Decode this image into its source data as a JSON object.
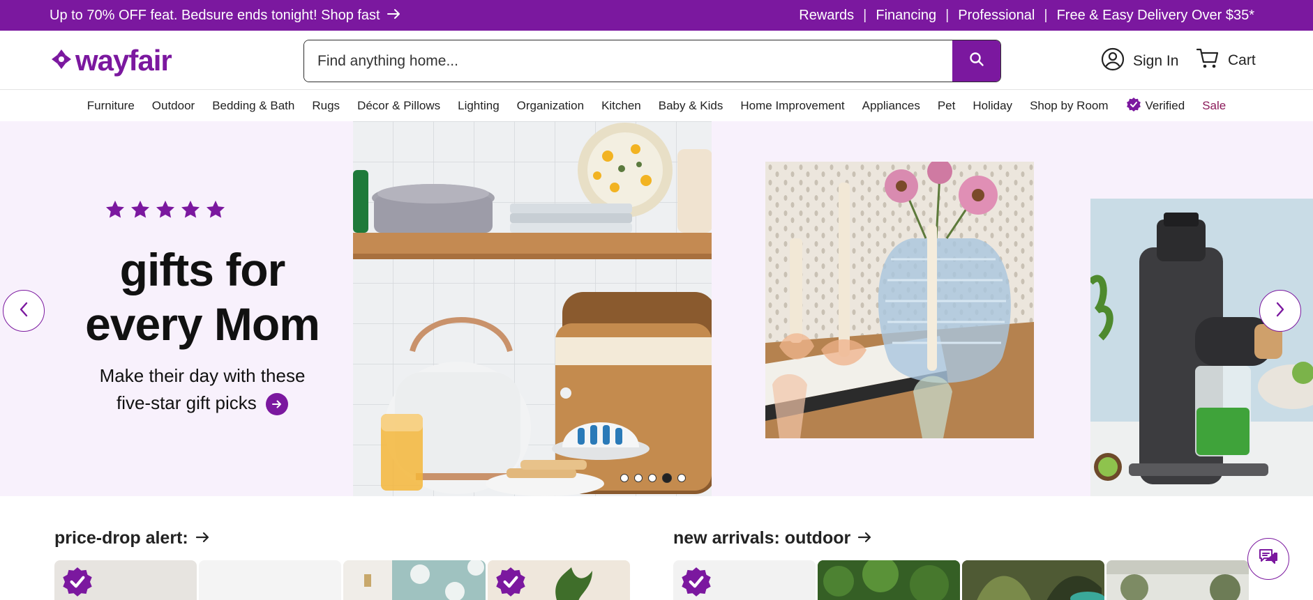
{
  "promo": {
    "text": "Up to 70% OFF feat. Bedsure ends tonight! Shop fast",
    "links": [
      "Rewards",
      "Financing",
      "Professional",
      "Free & Easy Delivery Over $35*"
    ]
  },
  "header": {
    "logo": "wayfair",
    "search_placeholder": "Find anything home...",
    "sign_in": "Sign In",
    "cart": "Cart"
  },
  "categories": [
    "Furniture",
    "Outdoor",
    "Bedding & Bath",
    "Rugs",
    "Décor & Pillows",
    "Lighting",
    "Organization",
    "Kitchen",
    "Baby & Kids",
    "Home Improvement",
    "Appliances",
    "Pet",
    "Holiday",
    "Shop by Room",
    "Verified",
    "Sale"
  ],
  "hero": {
    "rating_stars": 5,
    "headline_line1": "gifts for",
    "headline_line2": "every Mom",
    "sub_line1": "Make their day with these",
    "sub_line2": "five-star gift picks",
    "slide_count": 5,
    "active_slide_index": 3
  },
  "sections": {
    "left_title": "price-drop alert:",
    "right_title": "new arrivals: outdoor"
  },
  "colors": {
    "brand": "#7b189f",
    "hero_bg": "#f8f1fc",
    "sale": "#8b1a5a"
  },
  "icons": {
    "search": "search-icon",
    "account": "user-circle-icon",
    "cart": "cart-icon",
    "verified": "verified-badge-icon",
    "chat": "chat-icon"
  }
}
